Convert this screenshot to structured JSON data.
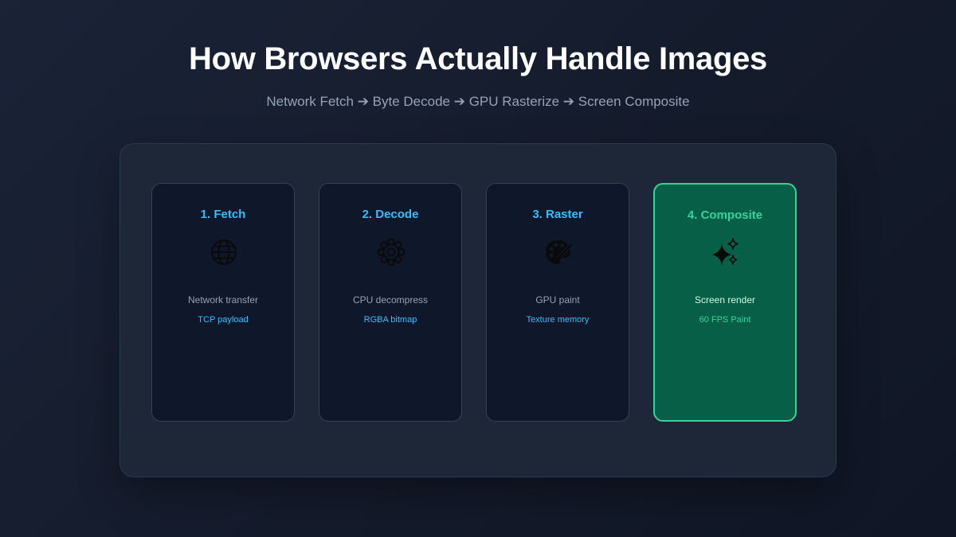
{
  "header": {
    "title": "How Browsers Actually Handle Images",
    "subtitle": "Network Fetch ➔ Byte Decode ➔ GPU Rasterize ➔ Screen Composite"
  },
  "stages": [
    {
      "title": "1. Fetch",
      "icon": "globe-icon",
      "description": "Network transfer",
      "note": "TCP payload"
    },
    {
      "title": "2. Decode",
      "icon": "gear-icon",
      "description": "CPU decompress",
      "note": "RGBA bitmap"
    },
    {
      "title": "3. Raster",
      "icon": "palette-icon",
      "description": "GPU paint",
      "note": "Texture memory"
    },
    {
      "title": "4. Composite",
      "icon": "sparkles-icon",
      "description": "Screen render",
      "note": "60 FPS Paint",
      "active": true
    }
  ],
  "colors": {
    "accent": "#38bdf8",
    "active_accent": "#34d399",
    "active_background": "#065f46",
    "card_background": "#0f172a"
  }
}
